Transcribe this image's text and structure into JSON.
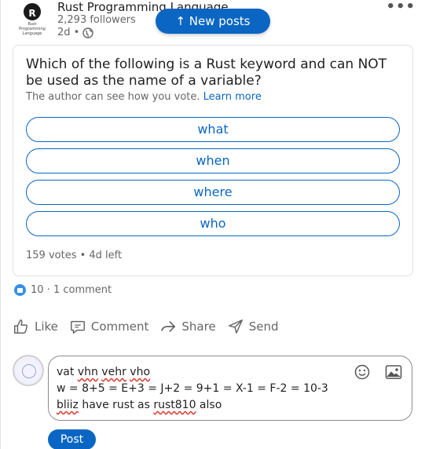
{
  "header": {
    "logo_text": "Rust Programming Language",
    "logo_letter": "R",
    "group_name": "Rust Programming Language",
    "followers": "2,293 followers",
    "age": "2d •",
    "new_posts_label": "↑ New posts"
  },
  "poll": {
    "question": "Which of the following is a Rust keyword and can NOT be used as the name of a variable?",
    "note": "The author can see how you vote.",
    "learn_more": "Learn more",
    "options": [
      "what",
      "when",
      "where",
      "who"
    ],
    "votes": "159 votes • 4d left"
  },
  "social": {
    "counts": "10 · 1 comment"
  },
  "actions": {
    "like": "Like",
    "comment": "Comment",
    "share": "Share",
    "send": "Send"
  },
  "compose": {
    "line1_a": "vat ",
    "line1_b": "vhn",
    "line1_c": " ",
    "line1_d": "vehr",
    "line1_e": " ",
    "line1_f": "vho",
    "line2": "w = 8+5 = E+3 = J+2 = 9+1 = X-1 = F-2 = 10-3",
    "line3_a": "bliiz",
    "line3_b": " have rust as ",
    "line3_c": "rust810",
    "line3_d": " also",
    "post_label": "Post"
  },
  "colors": {
    "accent": "#0a66c2",
    "like_badge": "#378fe9",
    "spellcheck": "#d93025"
  },
  "icons": [
    "globe-icon",
    "more-icon",
    "like-icon",
    "comment-icon",
    "share-icon",
    "send-icon",
    "emoji-icon",
    "image-icon"
  ]
}
